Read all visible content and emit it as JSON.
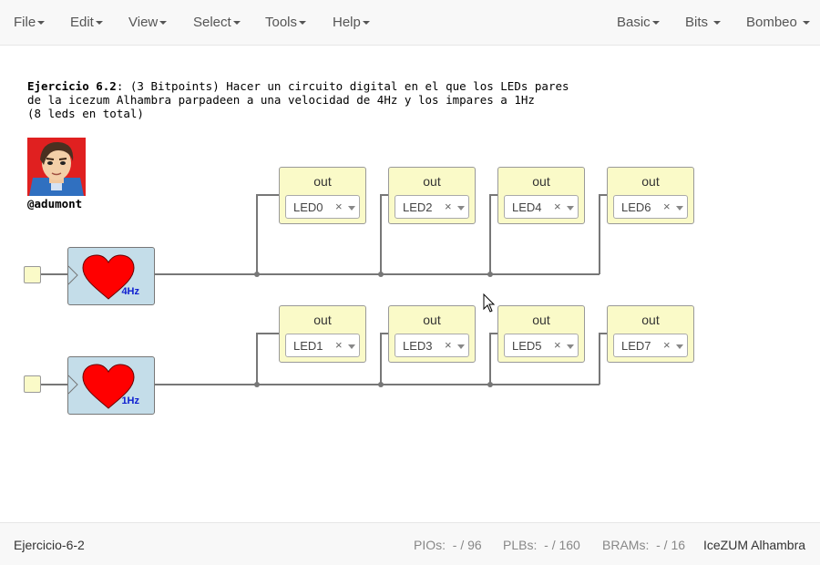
{
  "menu": {
    "left": [
      "File",
      "Edit",
      "View",
      "Select",
      "Tools",
      "Help"
    ],
    "right": [
      "Basic",
      "Bits",
      "Bombeo"
    ]
  },
  "comment": {
    "bold": "Ejercicio 6.2",
    "line1": ": (3 Bitpoints) Hacer un circuito digital en el que los LEDs pares",
    "line2": "de la icezum Alhambra parpadeen a una velocidad de 4Hz y los impares a 1Hz",
    "line3": "(8 leds en total)",
    "author": "@adumont",
    "avatar_icon": "avatar-cartoon-man"
  },
  "blocks": {
    "heart_top_freq": "4Hz",
    "heart_bottom_freq": "1Hz",
    "out_title": "out",
    "clear_symbol": "×",
    "top_leds": [
      "LED0",
      "LED2",
      "LED4",
      "LED6"
    ],
    "bottom_leds": [
      "LED1",
      "LED3",
      "LED5",
      "LED7"
    ]
  },
  "footer": {
    "project": "Ejercicio-6-2",
    "pios_label": "PIOs:",
    "pios_value": "- / 96",
    "plbs_label": "PLBs:",
    "plbs_value": "- / 160",
    "brams_label": "BRAMs:",
    "brams_value": "- / 16",
    "board": "IceZUM Alhambra"
  },
  "colors": {
    "heart": "#ff0000",
    "block_blue": "#c4dde9",
    "block_yellow": "#fafac8",
    "wire": "#777777",
    "freq_text": "#1020d0"
  }
}
